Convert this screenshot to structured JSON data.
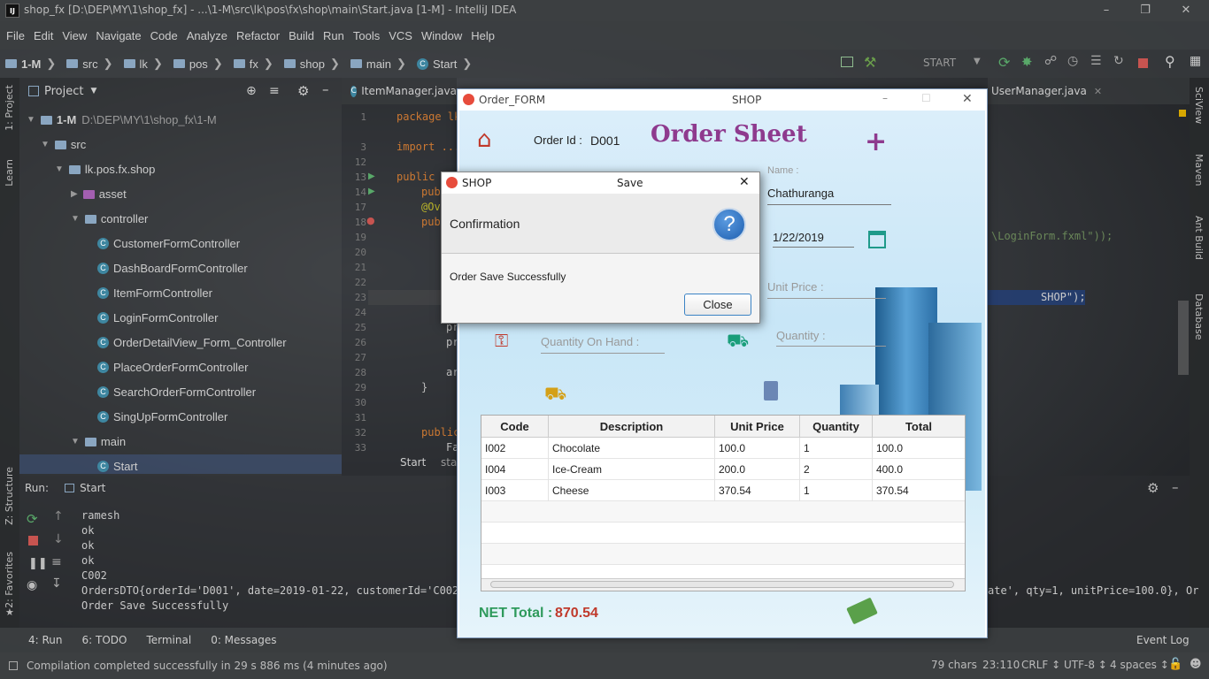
{
  "window": {
    "title": "shop_fx [D:\\DEP\\MY\\1\\shop_fx] - ...\\1-M\\src\\lk\\pos\\fx\\shop\\main\\Start.java [1-M] - IntelliJ IDEA",
    "logo": "IJ"
  },
  "menu": [
    "File",
    "Edit",
    "View",
    "Navigate",
    "Code",
    "Analyze",
    "Refactor",
    "Build",
    "Run",
    "Tools",
    "VCS",
    "Window",
    "Help"
  ],
  "breadcrumb": [
    "1-M",
    "src",
    "lk",
    "pos",
    "fx",
    "shop",
    "main",
    "Start"
  ],
  "run_config": "START",
  "left_tabs": [
    "1: Project",
    "Learn",
    "Z: Structure",
    "2: Favorites"
  ],
  "right_tabs": [
    "SciView",
    "Maven",
    "Ant Build",
    "Database"
  ],
  "project": {
    "header": "Project",
    "items": [
      "1-M",
      "D:\\DEP\\MY\\1\\shop_fx\\1-M",
      "src",
      "lk.pos.fx.shop",
      "asset",
      "controller",
      "CustomerFormController",
      "DashBoardFormController",
      "ItemFormController",
      "LoginFormController",
      "OrderDetailView_Form_Controller",
      "PlaceOrderFormController",
      "SearchOrderFormController",
      "SingUpFormController",
      "main",
      "Start"
    ]
  },
  "editor": {
    "tabs": [
      "ItemManager.java",
      "UserManager.java"
    ],
    "lines": [
      "1",
      "3",
      "12",
      "13",
      "14",
      "17",
      "18",
      "19",
      "20",
      "21",
      "22",
      "23",
      "24",
      "25",
      "26",
      "27",
      "28",
      "29",
      "30",
      "31",
      "32",
      "33"
    ],
    "code": [
      "package lk",
      "import ...",
      "public",
      "pub",
      "@Ov",
      "pub",
      "pr",
      "pr",
      "ar",
      "}",
      "public",
      "Fa"
    ],
    "right_code": [
      "\\LoginForm.fxml\"));",
      "SHOP\");"
    ],
    "breadcrumb_start": "Start",
    "breadcrumb_sta": "sta"
  },
  "run": {
    "label": "Run:",
    "config": "Start",
    "output": [
      "ramesh",
      "ok",
      "ok",
      "ok",
      "C002",
      "OrdersDTO{orderId='D001', date=2019-01-22, customerId='C002',",
      "Order Save Successfully"
    ],
    "output_tail": "ate', qty=1, unitPrice=100.0}, Or"
  },
  "bottom_tabs": [
    "4: Run",
    "6: TODO",
    "Terminal",
    "0: Messages",
    "Event Log"
  ],
  "status": {
    "message": "Compilation completed successfully in 29 s 886 ms (4 minutes ago)",
    "chars": "79 chars",
    "pos": "23:110",
    "crlf": "CRLF ↕",
    "enc": "UTF-8 ↕",
    "indent": "4 spaces ↕"
  },
  "order_form": {
    "window_title": "Order_FORM",
    "window_center": "SHOP",
    "order_id_label": "Order Id :",
    "order_id": "D001",
    "title": "Order Sheet",
    "name_label": "Name :",
    "name_value": "Chathuranga",
    "date": "1/22/2019",
    "unit_price_placeholder": "Unit Price :",
    "qoh_placeholder": "Quantity On Hand :",
    "qty_placeholder": "Quantity :",
    "table": {
      "headers": [
        "Code",
        "Description",
        "Unit Price",
        "Quantity",
        "Total"
      ],
      "rows": [
        [
          "I002",
          "Chocolate",
          "100.0",
          "1",
          "100.0"
        ],
        [
          "I004",
          "Ice-Cream",
          "200.0",
          "2",
          "400.0"
        ],
        [
          "I003",
          "Cheese",
          "370.54",
          "1",
          "370.54"
        ]
      ]
    },
    "net_total_label": "NET Total :",
    "net_total": "870.54"
  },
  "dialog": {
    "title": "SHOP",
    "center_title": "Save",
    "header": "Confirmation",
    "message": "Order Save Successfully",
    "button": "Close"
  },
  "colors": {
    "accent": "#3b83c5",
    "title_purple": "#8e3a8e",
    "net_green": "#2e9a5c",
    "net_red": "#c0392b"
  }
}
